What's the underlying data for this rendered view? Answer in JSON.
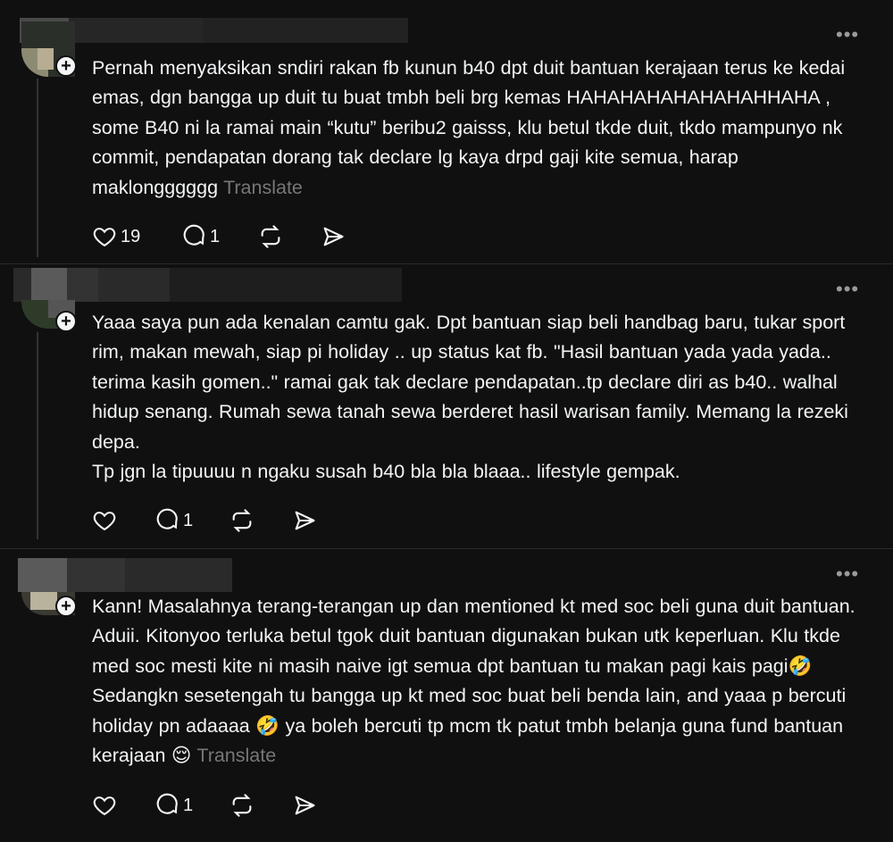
{
  "posts": [
    {
      "text": "Pernah menyaksikan sndiri rakan fb kunun b40 dpt duit bantuan kerajaan terus ke kedai emas, dgn bangga up duit tu buat tmbh beli brg kemas HAHAHAHAHAHAHAHHAHA , some B40 ni la ramai main “kutu” beribu2 gaisss, klu betul tkde duit, tkdo mampunyo nk commit, pendapatan dorang tak declare lg kaya drpd gaji kite semua, harap maklongggggg",
      "translate": "Translate",
      "likes": "19",
      "replies": "1"
    },
    {
      "text": "Yaaa saya pun ada kenalan camtu gak. Dpt bantuan siap beli handbag baru, tukar sport rim, makan mewah, siap pi holiday .. up status kat fb. \"Hasil bantuan yada yada yada.. terima kasih gomen..\" ramai gak tak declare pendapatan..tp declare diri as b40.. walhal hidup senang. Rumah sewa tanah sewa berderet hasil warisan family. Memang la rezeki depa.\nTp jgn la tipuuuu n ngaku susah b40 bla bla blaaa.. lifestyle gempak.",
      "translate": "",
      "likes": "",
      "replies": "1"
    },
    {
      "text": "Kann! Masalahnya terang-terangan up dan mentioned kt med soc beli guna duit bantuan. Aduii. Kitonyoo terluka betul tgok duit bantuan digunakan bukan utk keperluan. Klu tkde med soc mesti kite ni masih naive igt semua dpt bantuan tu makan pagi kais pagi🤣 Sedangkn sesetengah tu bangga up kt med soc buat beli benda lain, and yaaa p bercuti holiday pn adaaaa 🤣 ya boleh bercuti tp mcm tk patut tmbh belanja guna fund bantuan kerajaan 😌",
      "translate": "Translate",
      "likes": "",
      "replies": "1"
    }
  ],
  "icons": {
    "like": "heart-icon",
    "reply": "comment-icon",
    "repost": "repost-icon",
    "share": "send-icon",
    "more": "more-icon",
    "follow": "plus-icon"
  },
  "colors": {
    "background": "#101010",
    "text": "#f3f5f7",
    "muted": "#777777",
    "divider": "#2a2a2a"
  }
}
